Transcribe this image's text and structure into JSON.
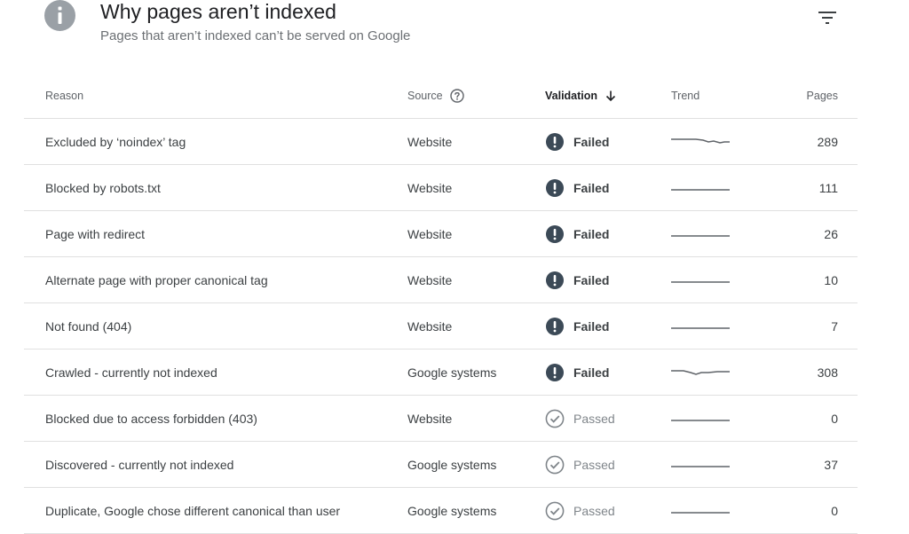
{
  "header": {
    "title": "Why pages aren’t indexed",
    "subtitle": "Pages that aren’t indexed can’t be served on Google",
    "info_icon": "info-icon",
    "filter_icon": "filter-icon"
  },
  "table": {
    "columns": {
      "reason": "Reason",
      "source": "Source",
      "validation": "Validation",
      "trend": "Trend",
      "pages": "Pages"
    },
    "sort_column": "validation",
    "sort_direction": "descending",
    "rows": [
      {
        "reason": "Excluded by ‘noindex’ tag",
        "source": "Website",
        "validation": "Failed",
        "status": "failed",
        "trend": "variable",
        "pages": "289"
      },
      {
        "reason": "Blocked by robots.txt",
        "source": "Website",
        "validation": "Failed",
        "status": "failed",
        "trend": "flat",
        "pages": "111"
      },
      {
        "reason": "Page with redirect",
        "source": "Website",
        "validation": "Failed",
        "status": "failed",
        "trend": "flat",
        "pages": "26"
      },
      {
        "reason": "Alternate page with proper canonical tag",
        "source": "Website",
        "validation": "Failed",
        "status": "failed",
        "trend": "flat",
        "pages": "10"
      },
      {
        "reason": "Not found (404)",
        "source": "Website",
        "validation": "Failed",
        "status": "failed",
        "trend": "flat",
        "pages": "7"
      },
      {
        "reason": "Crawled - currently not indexed",
        "source": "Google systems",
        "validation": "Failed",
        "status": "failed",
        "trend": "dip",
        "pages": "308"
      },
      {
        "reason": "Blocked due to access forbidden (403)",
        "source": "Website",
        "validation": "Passed",
        "status": "passed",
        "trend": "flat",
        "pages": "0"
      },
      {
        "reason": "Discovered - currently not indexed",
        "source": "Google systems",
        "validation": "Passed",
        "status": "passed",
        "trend": "flat",
        "pages": "37"
      },
      {
        "reason": "Duplicate, Google chose different canonical than user",
        "source": "Google systems",
        "validation": "Passed",
        "status": "passed",
        "trend": "flat",
        "pages": "0"
      }
    ]
  },
  "colors": {
    "failed_icon": "#3c4a57",
    "passed_icon": "#80868b",
    "divider": "#e0e0e0",
    "trend_line": "#5f6368"
  }
}
